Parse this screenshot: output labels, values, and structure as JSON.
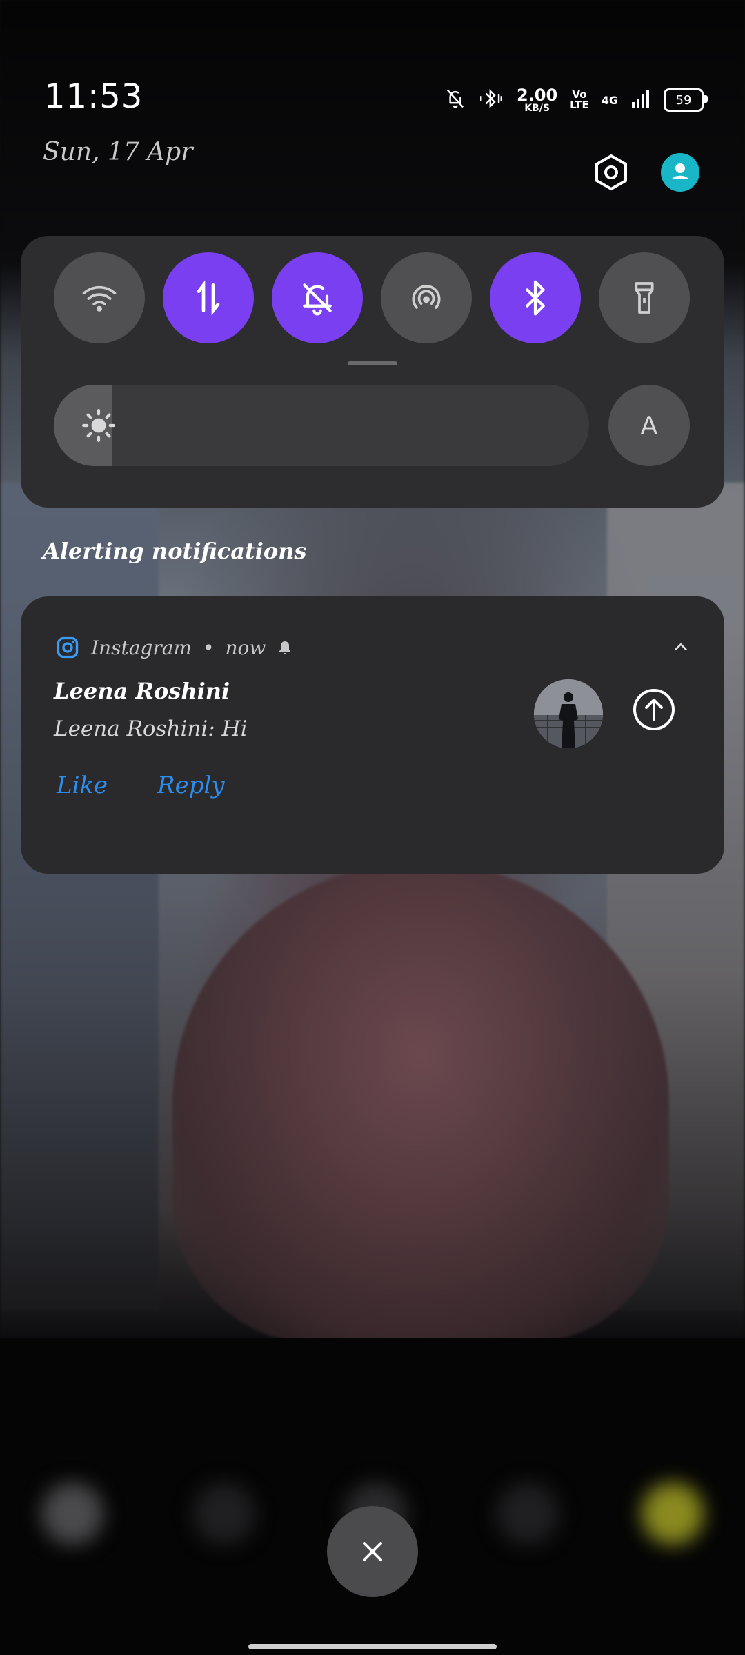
{
  "status_bar": {
    "time": "11:53",
    "date": "Sun, 17 Apr",
    "speed_value": "2.00",
    "speed_unit": "KB/S",
    "volte_top": "Vo",
    "volte_bottom": "LTE",
    "network": "4G",
    "battery": "59"
  },
  "quick_settings": {
    "tiles": [
      {
        "name": "wifi-icon",
        "active": false
      },
      {
        "name": "mobile-data-icon",
        "active": true
      },
      {
        "name": "bell-off-icon",
        "active": true
      },
      {
        "name": "hotspot-icon",
        "active": false
      },
      {
        "name": "bluetooth-icon",
        "active": true
      },
      {
        "name": "flashlight-icon",
        "active": false
      }
    ],
    "brightness_level": 0.11,
    "auto_brightness_label": "A"
  },
  "notifications": {
    "section_title": "Alerting notifications",
    "items": [
      {
        "app": "Instagram",
        "time": "now",
        "sender": "Leena Roshini",
        "message": "Leena Roshini: Hi",
        "actions": [
          "Like",
          "Reply"
        ]
      }
    ]
  },
  "colors": {
    "accent": "#7b3ff2",
    "link": "#2b8ef0",
    "panel": "#2d2d2f",
    "avatar": "#19b6c8"
  }
}
